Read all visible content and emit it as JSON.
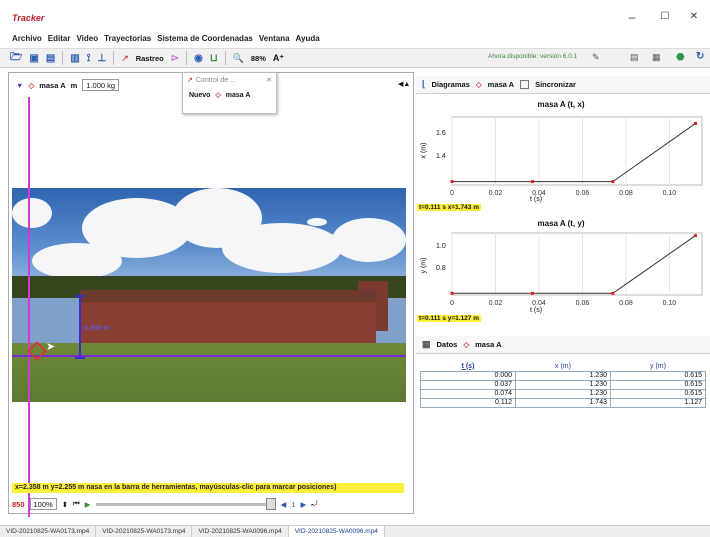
{
  "window": {
    "app_title": "Tracker",
    "minimize": "–",
    "maximize": "☐",
    "close": "✕"
  },
  "menu": [
    "Archivo",
    "Editar",
    "Video",
    "Trayectorias",
    "Sistema de Coordenadas",
    "Ventana",
    "Ayuda"
  ],
  "toolbar": {
    "rastreo": "Rastreo",
    "zoom": "88%",
    "update": "Ahora disponible: versión 6.0.1"
  },
  "objbar": {
    "mass_label": "masa A",
    "m_label": "m",
    "mass_value": "1.000 kg"
  },
  "popup": {
    "title": "Control de ...",
    "nuevo": "Nuevo",
    "item": "masa A"
  },
  "video": {
    "measure_label": "6.000 m"
  },
  "status": "x=2.358 m  y=2.255 m nasa en la barra de herramientas, mayúsculas-clic para marcar posiciones)",
  "player": {
    "frame": "850",
    "zoom": "100%"
  },
  "graph_panel": {
    "diagramas": "Diagramas",
    "track": "masa A",
    "sync": "Sincronizar"
  },
  "plot1": {
    "title": "masa A (t, x)",
    "ylabel": "x (m)",
    "xlabel": "t (s)",
    "yticks": [
      "1.6",
      "1.4"
    ],
    "xticks": [
      "0",
      "0.02",
      "0.04",
      "0.06",
      "0.08",
      "0.10"
    ],
    "readout": "t=0.111 s  x=1.743 m"
  },
  "plot2": {
    "title": "masa A (t, y)",
    "ylabel": "y (m)",
    "xlabel": "t (s)",
    "yticks": [
      "1.0",
      "0.8"
    ],
    "xticks": [
      "0",
      "0.02",
      "0.04",
      "0.06",
      "0.08",
      "0.10"
    ],
    "readout": "t=0.111 s  y=1.127 m"
  },
  "data_panel": {
    "datos": "Datos",
    "track": "masa A"
  },
  "table": {
    "headers": [
      "t (s)",
      "x (m)",
      "y (m)"
    ],
    "rows": [
      [
        "0.000",
        "1.230",
        "0.615"
      ],
      [
        "0.037",
        "1.230",
        "0.615"
      ],
      [
        "0.074",
        "1.230",
        "0.615"
      ],
      [
        "0.112",
        "1.743",
        "1.127"
      ]
    ]
  },
  "tabs": [
    "VID-20210825-WA0173.mp4",
    "VID-20210825-WA0173.mp4",
    "VID-20210825-WA0096.mp4",
    "VID-20210825-WA0096.mp4"
  ],
  "chart_data": [
    {
      "type": "line",
      "title": "masa A (t, x)",
      "xlabel": "t (s)",
      "ylabel": "x (m)",
      "x": [
        0.0,
        0.037,
        0.074,
        0.112
      ],
      "y": [
        1.23,
        1.23,
        1.23,
        1.743
      ],
      "xlim": [
        0,
        0.115
      ],
      "ylim": [
        1.2,
        1.8
      ]
    },
    {
      "type": "line",
      "title": "masa A (t, y)",
      "xlabel": "t (s)",
      "ylabel": "y (m)",
      "x": [
        0.0,
        0.037,
        0.074,
        0.112
      ],
      "y": [
        0.615,
        0.615,
        0.615,
        1.127
      ],
      "xlim": [
        0,
        0.115
      ],
      "ylim": [
        0.6,
        1.15
      ]
    }
  ]
}
